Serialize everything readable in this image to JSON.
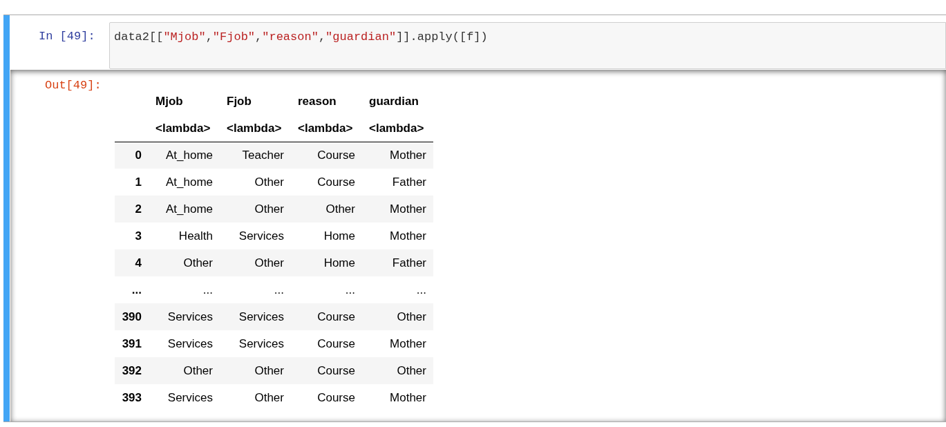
{
  "input_cell": {
    "prompt": "In [49]:",
    "code": [
      {
        "kind": "plain",
        "text": "data2[["
      },
      {
        "kind": "string",
        "text": "\"Mjob\""
      },
      {
        "kind": "plain",
        "text": ","
      },
      {
        "kind": "string",
        "text": "\"Fjob\""
      },
      {
        "kind": "plain",
        "text": ","
      },
      {
        "kind": "string",
        "text": "\"reason\""
      },
      {
        "kind": "plain",
        "text": ","
      },
      {
        "kind": "string",
        "text": "\"guardian\""
      },
      {
        "kind": "plain",
        "text": "]].apply([f])"
      }
    ]
  },
  "output_cell": {
    "prompt": "Out[49]:",
    "table": {
      "columns": [
        "Mjob",
        "Fjob",
        "reason",
        "guardian"
      ],
      "subcolumns": [
        "<lambda>",
        "<lambda>",
        "<lambda>",
        "<lambda>"
      ],
      "rows": [
        {
          "index": "0",
          "cells": [
            "At_home",
            "Teacher",
            "Course",
            "Mother"
          ]
        },
        {
          "index": "1",
          "cells": [
            "At_home",
            "Other",
            "Course",
            "Father"
          ]
        },
        {
          "index": "2",
          "cells": [
            "At_home",
            "Other",
            "Other",
            "Mother"
          ]
        },
        {
          "index": "3",
          "cells": [
            "Health",
            "Services",
            "Home",
            "Mother"
          ]
        },
        {
          "index": "4",
          "cells": [
            "Other",
            "Other",
            "Home",
            "Father"
          ]
        },
        {
          "index": "...",
          "cells": [
            "...",
            "...",
            "...",
            "..."
          ]
        },
        {
          "index": "390",
          "cells": [
            "Services",
            "Services",
            "Course",
            "Other"
          ]
        },
        {
          "index": "391",
          "cells": [
            "Services",
            "Services",
            "Course",
            "Mother"
          ]
        },
        {
          "index": "392",
          "cells": [
            "Other",
            "Other",
            "Course",
            "Other"
          ]
        },
        {
          "index": "393",
          "cells": [
            "Services",
            "Other",
            "Course",
            "Mother"
          ]
        }
      ]
    }
  }
}
